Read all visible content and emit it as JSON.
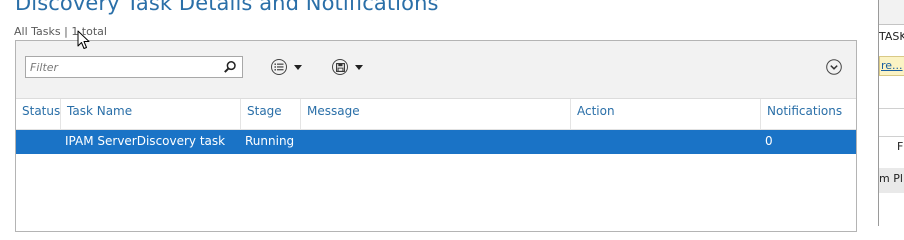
{
  "page": {
    "title": "Discovery Task Details and Notifications",
    "summary_prefix": "All Tasks | ",
    "summary_count": "1",
    "summary_suffix": " total"
  },
  "toolbar": {
    "filter_placeholder": "Filter",
    "icons": [
      "search-icon",
      "list-options-icon",
      "save-query-icon",
      "expand-icon"
    ]
  },
  "table": {
    "columns": [
      "Status",
      "Task Name",
      "Stage",
      "Message",
      "Action",
      "Notifications"
    ],
    "rows": [
      {
        "status": "",
        "task_name": "IPAM ServerDiscovery task",
        "stage": "Running",
        "message": "",
        "action": "",
        "notifications": "0"
      }
    ]
  },
  "side_panel": {
    "tasks_label": "TASKS",
    "link_text": "re...",
    "row_text": "F",
    "bottom_text": "m  Pl"
  },
  "colors": {
    "title": "#2a6fa8",
    "header_text": "#2a6fa8",
    "selected_row": "#1a73c6",
    "toolbar_bg": "#f2f2f2"
  }
}
